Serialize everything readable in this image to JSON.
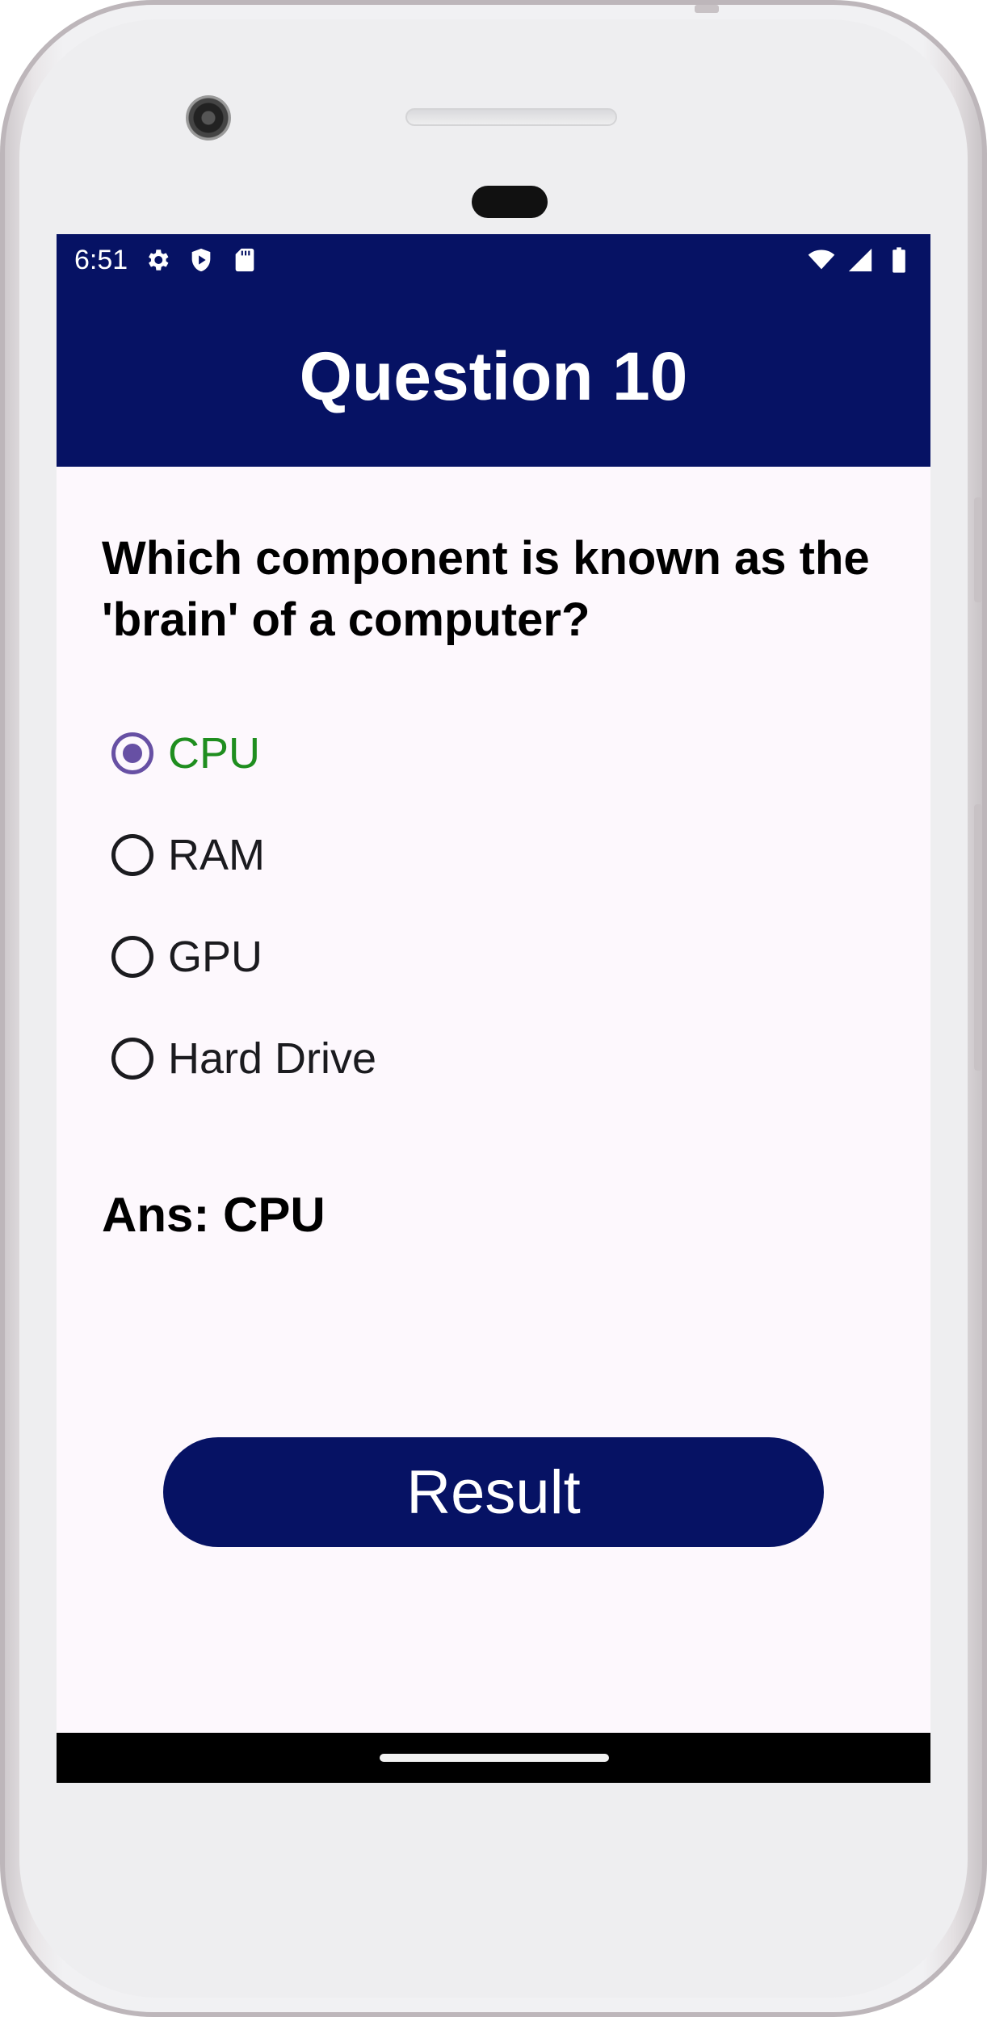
{
  "status_bar": {
    "time": "6:51",
    "left_icons": [
      "settings-icon",
      "shield-icon",
      "sd-card-icon"
    ],
    "right_icons": [
      "wifi-icon",
      "signal-icon",
      "battery-icon"
    ]
  },
  "app_bar": {
    "title": "Question 10"
  },
  "question": {
    "text": "Which component is known as the 'brain' of a computer?"
  },
  "options": [
    {
      "label": "CPU",
      "selected": true,
      "correct": true
    },
    {
      "label": "RAM",
      "selected": false,
      "correct": false
    },
    {
      "label": "GPU",
      "selected": false,
      "correct": false
    },
    {
      "label": "Hard Drive",
      "selected": false,
      "correct": false
    }
  ],
  "answer": {
    "text": "Ans: CPU"
  },
  "result_button": {
    "label": "Result"
  },
  "colors": {
    "primary": "#061264",
    "selected_radio": "#6750a4",
    "correct_text": "#1f8e1f",
    "background": "#fdf8fd"
  }
}
